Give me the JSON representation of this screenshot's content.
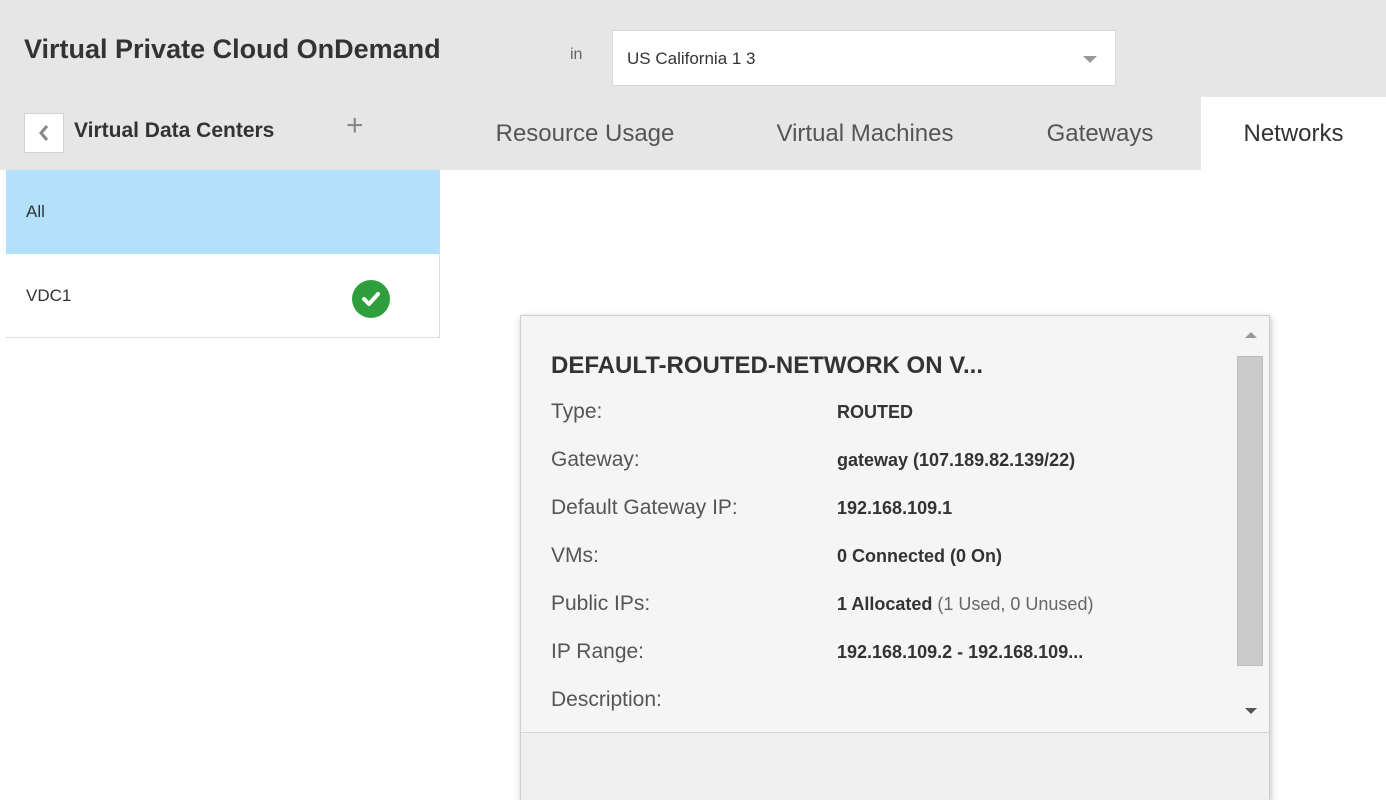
{
  "header": {
    "app_title": "Virtual Private Cloud OnDemand",
    "in_label": "in",
    "region_value": "US California 1 3"
  },
  "vdc_header": {
    "title": "Virtual Data Centers",
    "back_icon": "chevron-left-icon",
    "add_icon": "plus-icon"
  },
  "tabs": [
    {
      "label": "Resource Usage",
      "active": false
    },
    {
      "label": "Virtual Machines",
      "active": false
    },
    {
      "label": "Gateways",
      "active": false
    },
    {
      "label": "Networks",
      "active": true
    }
  ],
  "sidebar": {
    "items": [
      {
        "label": "All",
        "selected": true
      },
      {
        "label": "VDC1",
        "status_icon": "check-circle-icon",
        "status_color": "#2f9e3c"
      }
    ]
  },
  "popup": {
    "title": "DEFAULT-ROUTED-NETWORK ON V...",
    "rows": [
      {
        "label": "Type:",
        "value": "ROUTED"
      },
      {
        "label": "Gateway:",
        "value": "gateway (107.189.82.139/22)"
      },
      {
        "label": "Default Gateway IP:",
        "value": "192.168.109.1"
      },
      {
        "label": "VMs:",
        "value": "0 Connected (0 On)"
      },
      {
        "label": "Public IPs:",
        "value_bold": "1 Allocated",
        "value_light": " (1 Used, 0 Unused)"
      },
      {
        "label": "IP Range:",
        "value": "192.168.109.2 - 192.168.109..."
      },
      {
        "label": "Description:",
        "value": ""
      }
    ]
  },
  "colors": {
    "selected_item": "#b3e0fb",
    "header_bg": "#e6e6e6",
    "status_ok": "#2f9e3c"
  }
}
